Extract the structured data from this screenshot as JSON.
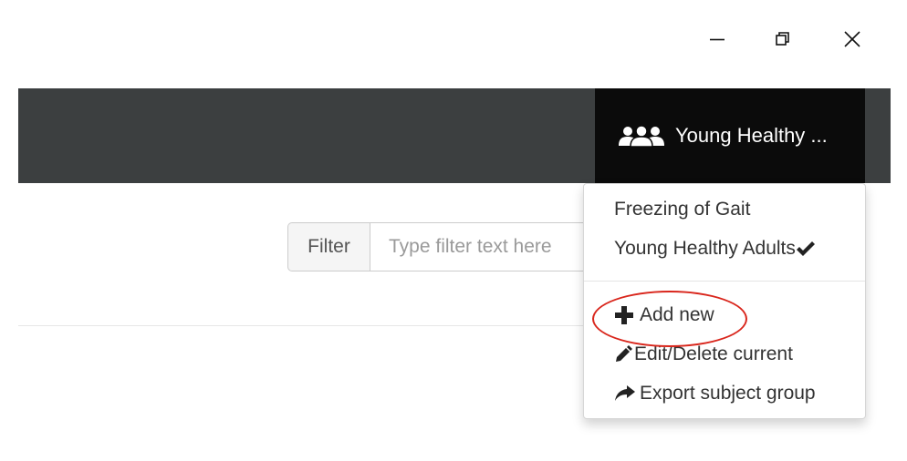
{
  "window_controls": {
    "minimize": "minimize-icon",
    "restore": "restore-icon",
    "close": "close-icon"
  },
  "navbar": {
    "group_selector": {
      "icon": "users-icon",
      "label": "Young Healthy ..."
    }
  },
  "filter": {
    "label": "Filter",
    "placeholder": "Type filter text here",
    "value": ""
  },
  "dropdown": {
    "groups": [
      {
        "label": "Freezing of Gait",
        "selected": false
      },
      {
        "label": "Young Healthy Adults",
        "selected": true,
        "icon": "checkmark-icon"
      }
    ],
    "actions": [
      {
        "label": "Add new",
        "icon": "plus-icon"
      },
      {
        "label": "Edit/Delete current",
        "icon": "pencil-icon"
      },
      {
        "label": "Export subject group",
        "icon": "share-arrow-icon"
      }
    ]
  },
  "colors": {
    "navbar_bg": "#3c3f40",
    "group_button_bg": "#0b0b0b",
    "highlight_circle": "#d9261c"
  }
}
